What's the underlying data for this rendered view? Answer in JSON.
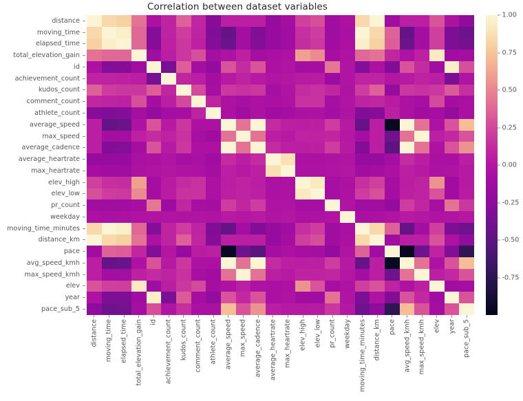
{
  "title": "Correlation between dataset variables",
  "colorbar": {
    "ticks": [
      "1.00",
      "0.75",
      "0.50",
      "0.25",
      "0.00",
      "-0.25",
      "-0.50",
      "-0.75"
    ],
    "tick_values": [
      1.0,
      0.75,
      0.5,
      0.25,
      0.0,
      -0.25,
      -0.5,
      -0.75
    ],
    "vmin": -1.0,
    "vmax": 1.0,
    "colormap": "rocket"
  },
  "chart_data": {
    "type": "heatmap",
    "title": "Correlation between dataset variables",
    "xlabel": "",
    "ylabel": "",
    "colormap": "rocket",
    "zlim": [
      -1.0,
      1.0
    ],
    "grid": false,
    "legend_position": "right",
    "categories": [
      "distance",
      "moving_time",
      "elapsed_time",
      "total_elevation_gain",
      "id",
      "achievement_count",
      "kudos_count",
      "comment_count",
      "athlete_count",
      "average_speed",
      "max_speed",
      "average_cadence",
      "average_heartrate",
      "max_heartrate",
      "elev_high",
      "elev_low",
      "pr_count",
      "weekday",
      "moving_time_minutes",
      "distance_km",
      "pace",
      "avg_speed_kmh",
      "max_speed_kmh",
      "elev",
      "year",
      "pace_sub_5"
    ],
    "x": [
      "distance",
      "moving_time",
      "elapsed_time",
      "total_elevation_gain",
      "id",
      "achievement_count",
      "kudos_count",
      "comment_count",
      "athlete_count",
      "average_speed",
      "max_speed",
      "average_cadence",
      "average_heartrate",
      "max_heartrate",
      "elev_high",
      "elev_low",
      "pr_count",
      "weekday",
      "moving_time_minutes",
      "distance_km",
      "pace",
      "avg_speed_kmh",
      "max_speed_kmh",
      "elev",
      "year",
      "pace_sub_5"
    ],
    "y": [
      "distance",
      "moving_time",
      "elapsed_time",
      "total_elevation_gain",
      "id",
      "achievement_count",
      "kudos_count",
      "comment_count",
      "athlete_count",
      "average_speed",
      "max_speed",
      "average_cadence",
      "average_heartrate",
      "max_heartrate",
      "elev_high",
      "elev_low",
      "pr_count",
      "weekday",
      "moving_time_minutes",
      "distance_km",
      "pace",
      "avg_speed_kmh",
      "max_speed_kmh",
      "elev",
      "year",
      "pace_sub_5"
    ],
    "values": [
      [
        1.0,
        0.84,
        0.8,
        0.42,
        -0.05,
        0.08,
        0.35,
        0.1,
        -0.27,
        0.05,
        0.05,
        0.05,
        -0.18,
        -0.09,
        0.22,
        0.28,
        -0.12,
        -0.05,
        0.84,
        1.0,
        -0.12,
        0.05,
        0.05,
        0.3,
        -0.04,
        -0.22
      ],
      [
        0.84,
        1.0,
        0.96,
        0.38,
        -0.28,
        0.08,
        0.2,
        0.08,
        -0.3,
        -0.44,
        -0.1,
        -0.3,
        -0.18,
        -0.12,
        0.14,
        0.2,
        -0.13,
        -0.06,
        1.0,
        0.84,
        0.36,
        -0.44,
        -0.1,
        0.22,
        -0.33,
        -0.4
      ],
      [
        0.8,
        0.96,
        1.0,
        0.38,
        -0.27,
        0.07,
        0.18,
        0.07,
        -0.29,
        -0.42,
        -0.1,
        -0.29,
        -0.18,
        -0.12,
        0.13,
        0.19,
        -0.12,
        -0.05,
        0.96,
        0.8,
        0.34,
        -0.42,
        -0.1,
        0.21,
        -0.32,
        -0.38
      ],
      [
        0.42,
        0.38,
        0.38,
        1.0,
        -0.13,
        0.05,
        0.18,
        0.28,
        -0.1,
        -0.04,
        0.07,
        -0.1,
        -0.06,
        -0.04,
        0.6,
        0.52,
        -0.08,
        -0.03,
        0.38,
        0.42,
        0.1,
        -0.04,
        0.07,
        0.93,
        -0.13,
        -0.1
      ],
      [
        -0.05,
        -0.28,
        -0.27,
        -0.13,
        1.0,
        -0.35,
        0.34,
        -0.1,
        -0.2,
        0.3,
        0.12,
        0.3,
        -0.05,
        -0.02,
        -0.1,
        -0.09,
        0.44,
        -0.02,
        -0.28,
        -0.05,
        -0.3,
        0.3,
        0.12,
        -0.13,
        0.96,
        0.28
      ],
      [
        0.08,
        0.08,
        0.07,
        0.05,
        -0.35,
        1.0,
        0.1,
        0.05,
        -0.1,
        0.02,
        0.08,
        0.02,
        -0.02,
        0.0,
        0.03,
        0.04,
        -0.15,
        -0.02,
        0.08,
        0.08,
        0.0,
        0.02,
        0.08,
        0.05,
        -0.34,
        -0.02
      ],
      [
        0.35,
        0.2,
        0.18,
        0.18,
        0.34,
        0.1,
        1.0,
        0.26,
        -0.08,
        0.18,
        0.15,
        0.18,
        -0.08,
        -0.03,
        0.12,
        0.15,
        0.1,
        -0.03,
        0.2,
        0.35,
        -0.18,
        0.18,
        0.15,
        0.18,
        0.33,
        0.14
      ],
      [
        0.1,
        0.08,
        0.07,
        0.28,
        -0.1,
        0.05,
        0.26,
        1.0,
        0.08,
        -0.05,
        -0.08,
        -0.05,
        -0.06,
        -0.04,
        0.15,
        0.15,
        -0.08,
        -0.02,
        0.08,
        0.1,
        0.04,
        -0.05,
        -0.08,
        0.26,
        -0.1,
        -0.06
      ],
      [
        -0.27,
        -0.3,
        -0.29,
        -0.1,
        -0.2,
        -0.1,
        -0.08,
        0.08,
        1.0,
        -0.05,
        -0.12,
        -0.05,
        -0.12,
        -0.1,
        -0.05,
        -0.05,
        -0.1,
        -0.03,
        -0.3,
        -0.27,
        0.06,
        -0.05,
        -0.12,
        -0.09,
        -0.2,
        -0.06
      ],
      [
        0.05,
        -0.44,
        -0.42,
        -0.04,
        0.3,
        0.02,
        0.18,
        -0.05,
        -0.05,
        1.0,
        0.42,
        1.0,
        0.12,
        0.06,
        0.05,
        0.06,
        0.2,
        0.02,
        -0.44,
        0.05,
        -0.96,
        1.0,
        0.42,
        -0.04,
        0.3,
        0.72
      ],
      [
        0.05,
        -0.1,
        -0.1,
        0.07,
        0.12,
        0.08,
        0.15,
        -0.08,
        -0.12,
        0.42,
        1.0,
        0.42,
        0.05,
        0.02,
        0.08,
        0.08,
        0.1,
        0.01,
        -0.1,
        0.05,
        -0.4,
        0.42,
        1.0,
        0.06,
        0.11,
        0.3
      ],
      [
        0.05,
        -0.3,
        -0.29,
        -0.1,
        0.3,
        0.02,
        0.18,
        -0.05,
        -0.05,
        1.0,
        0.42,
        1.0,
        0.12,
        0.06,
        0.05,
        0.06,
        0.2,
        0.02,
        -0.3,
        0.05,
        -0.5,
        1.0,
        0.42,
        -0.04,
        0.3,
        0.55
      ],
      [
        -0.18,
        -0.18,
        -0.18,
        -0.06,
        -0.05,
        -0.02,
        -0.08,
        -0.06,
        -0.12,
        0.12,
        0.05,
        0.12,
        1.0,
        0.88,
        -0.05,
        -0.05,
        -0.03,
        -0.02,
        -0.18,
        -0.18,
        -0.1,
        0.12,
        0.05,
        -0.06,
        -0.06,
        0.05
      ],
      [
        -0.09,
        -0.12,
        -0.12,
        -0.04,
        -0.02,
        0.0,
        -0.03,
        -0.04,
        -0.1,
        0.06,
        0.02,
        0.06,
        0.88,
        1.0,
        -0.04,
        -0.04,
        -0.02,
        -0.01,
        -0.12,
        -0.09,
        -0.05,
        0.06,
        0.02,
        -0.04,
        -0.03,
        0.02
      ],
      [
        0.22,
        0.14,
        0.13,
        0.6,
        -0.1,
        0.03,
        0.12,
        0.15,
        -0.05,
        0.05,
        0.08,
        0.05,
        -0.05,
        -0.04,
        1.0,
        0.92,
        -0.08,
        -0.05,
        0.14,
        0.22,
        -0.08,
        0.05,
        0.08,
        0.55,
        -0.12,
        0.02
      ],
      [
        0.28,
        0.2,
        0.19,
        0.52,
        -0.09,
        0.04,
        0.15,
        0.15,
        -0.05,
        0.06,
        0.08,
        0.06,
        -0.05,
        -0.04,
        0.92,
        1.0,
        -0.08,
        -0.04,
        0.2,
        0.28,
        -0.1,
        0.06,
        0.08,
        0.3,
        -0.11,
        0.03
      ],
      [
        -0.12,
        -0.13,
        -0.12,
        -0.08,
        0.44,
        -0.15,
        0.1,
        -0.08,
        -0.1,
        0.2,
        0.1,
        0.2,
        -0.03,
        -0.02,
        -0.08,
        -0.08,
        1.0,
        -0.02,
        -0.13,
        -0.12,
        -0.2,
        0.2,
        0.1,
        -0.08,
        0.42,
        0.18
      ],
      [
        -0.05,
        -0.06,
        -0.05,
        -0.03,
        -0.02,
        -0.02,
        -0.03,
        -0.02,
        -0.03,
        0.02,
        0.01,
        0.02,
        -0.02,
        -0.01,
        -0.05,
        -0.04,
        -0.02,
        1.0,
        -0.06,
        -0.05,
        -0.02,
        0.02,
        0.01,
        -0.03,
        -0.02,
        0.01
      ],
      [
        0.84,
        1.0,
        0.96,
        0.38,
        -0.28,
        0.08,
        0.2,
        0.08,
        -0.3,
        -0.44,
        -0.1,
        -0.3,
        -0.18,
        -0.12,
        0.14,
        0.2,
        -0.13,
        -0.06,
        1.0,
        0.84,
        0.36,
        -0.44,
        -0.1,
        0.22,
        -0.33,
        -0.4
      ],
      [
        1.0,
        0.84,
        0.8,
        0.42,
        -0.05,
        0.08,
        0.35,
        0.1,
        -0.27,
        0.05,
        0.05,
        0.05,
        -0.18,
        -0.09,
        0.22,
        0.28,
        -0.12,
        -0.05,
        0.84,
        1.0,
        -0.12,
        0.05,
        0.05,
        0.3,
        -0.04,
        -0.22
      ],
      [
        -0.12,
        0.36,
        0.34,
        0.1,
        -0.3,
        0.0,
        -0.18,
        0.04,
        0.06,
        -0.96,
        -0.4,
        -0.5,
        -0.1,
        -0.05,
        -0.08,
        -0.1,
        -0.2,
        -0.02,
        0.36,
        -0.12,
        1.0,
        -0.96,
        -0.4,
        0.08,
        -0.3,
        -0.74
      ],
      [
        0.05,
        -0.44,
        -0.42,
        -0.04,
        0.3,
        0.02,
        0.18,
        -0.05,
        -0.05,
        1.0,
        0.42,
        1.0,
        0.12,
        0.06,
        0.05,
        0.06,
        0.2,
        0.02,
        -0.44,
        0.05,
        -0.96,
        1.0,
        0.42,
        -0.04,
        0.3,
        0.72
      ],
      [
        0.05,
        -0.1,
        -0.1,
        0.07,
        0.12,
        0.08,
        0.15,
        -0.08,
        -0.12,
        0.42,
        1.0,
        0.42,
        0.05,
        0.02,
        0.08,
        0.08,
        0.1,
        0.01,
        -0.1,
        0.05,
        -0.4,
        0.42,
        1.0,
        0.06,
        0.11,
        0.3
      ],
      [
        0.3,
        0.22,
        0.21,
        0.93,
        -0.13,
        0.05,
        0.18,
        0.26,
        -0.09,
        -0.04,
        0.06,
        -0.04,
        -0.06,
        -0.04,
        0.55,
        0.3,
        -0.08,
        -0.03,
        0.22,
        0.3,
        0.08,
        -0.04,
        0.06,
        1.0,
        -0.13,
        -0.09
      ],
      [
        -0.04,
        -0.33,
        -0.32,
        -0.13,
        0.96,
        -0.34,
        0.33,
        -0.1,
        -0.2,
        0.3,
        0.11,
        0.3,
        -0.06,
        -0.03,
        -0.12,
        -0.11,
        0.42,
        -0.02,
        -0.33,
        -0.04,
        -0.3,
        0.3,
        0.11,
        -0.13,
        1.0,
        0.3
      ],
      [
        -0.22,
        -0.4,
        -0.38,
        -0.1,
        0.28,
        -0.02,
        0.14,
        -0.06,
        -0.06,
        0.72,
        0.3,
        0.55,
        0.05,
        0.02,
        0.02,
        0.03,
        0.18,
        0.01,
        -0.4,
        -0.22,
        -0.74,
        0.72,
        0.3,
        -0.09,
        0.3,
        1.0
      ]
    ]
  }
}
